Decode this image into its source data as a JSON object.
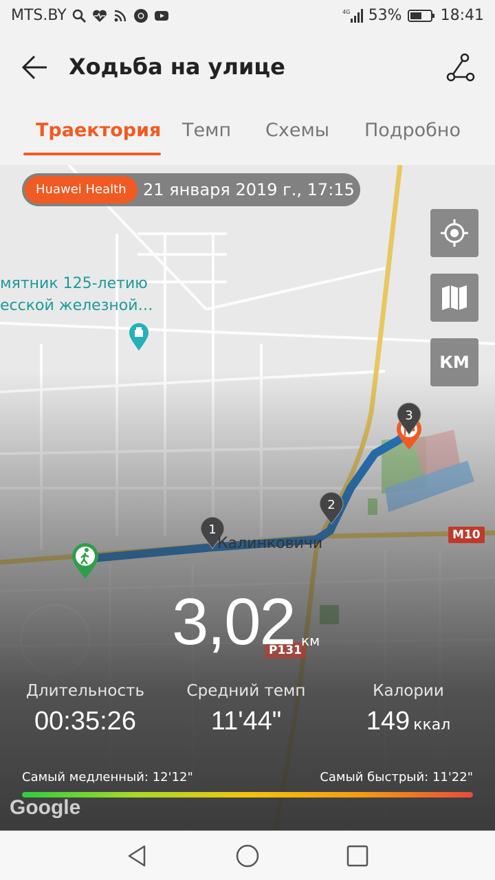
{
  "status_bar": {
    "carrier": "MTS.BY",
    "network": "4G",
    "battery": "53%",
    "time": "18:41"
  },
  "header": {
    "title": "Ходьба на улице",
    "back_icon": "arrow-left-icon",
    "share_icon": "share-route-icon"
  },
  "tabs": [
    {
      "label": "Траектория",
      "active": true
    },
    {
      "label": "Темп",
      "active": false
    },
    {
      "label": "Схемы",
      "active": false
    },
    {
      "label": "Подробно",
      "active": false
    }
  ],
  "map": {
    "source_badge": "Huawei Health",
    "date": "21 января 2019 г., 17:15",
    "poi_line1": "мятник 125-летию",
    "poi_line2": "есской железной…",
    "city": "Калинковичи",
    "road_m10": "M10",
    "road_p131": "P131",
    "markers": [
      "1",
      "2",
      "3"
    ],
    "buttons": {
      "locate_icon": "crosshair-icon",
      "map_icon": "map-icon",
      "units": "КМ"
    },
    "google": "Google"
  },
  "summary": {
    "distance": "3,02",
    "distance_unit": "км",
    "duration_label": "Длительность",
    "duration": "00:35:26",
    "pace_label": "Средний темп",
    "pace": "11'44\"",
    "calories_label": "Калории",
    "calories": "149",
    "calories_unit": "ккал",
    "slowest": "Самый медленный: 12'12\"",
    "fastest": "Самый быстрый: 11'22\""
  },
  "colors": {
    "accent": "#f15a22",
    "route": "#1e78c8"
  }
}
